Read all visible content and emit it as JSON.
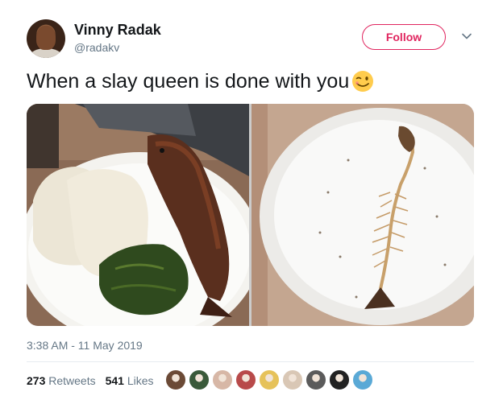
{
  "author": {
    "name": "Vinny Radak",
    "handle": "@radakv"
  },
  "follow_label": "Follow",
  "tweet_text": "When a slay queen is done with you",
  "emoji": "winking-face",
  "timestamp": "3:38 AM - 11 May 2019",
  "stats": {
    "retweets_count": "273",
    "retweets_label": "Retweets",
    "likes_count": "541",
    "likes_label": "Likes"
  },
  "likers": [
    {
      "color": "#6b4a36"
    },
    {
      "color": "#3a5a3a"
    },
    {
      "color": "#d7b7a6"
    },
    {
      "color": "#b84a4a"
    },
    {
      "color": "#e6c25a"
    },
    {
      "color": "#d9c7b5"
    },
    {
      "color": "#5b5b5b"
    },
    {
      "color": "#222222"
    },
    {
      "color": "#5aa9d6"
    }
  ],
  "colors": {
    "accent": "#e0245e",
    "text": "#14171a",
    "secondary": "#657786"
  }
}
